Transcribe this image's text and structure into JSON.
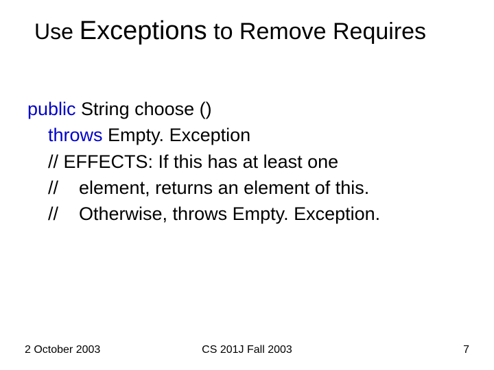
{
  "title": {
    "use": "Use ",
    "exceptions": "Exceptions",
    "rest": " to Remove Requires"
  },
  "code": {
    "l1_kw1": "public",
    "l1_rest": " String choose ()",
    "l2_indent": "    ",
    "l2_kw1": "throws",
    "l2_rest": " Empty. Exception",
    "l3": "    // EFFECTS: If this has at least one",
    "l4": "    //    element, returns an element of this.",
    "l5": "    //    Otherwise, throws Empty. Exception."
  },
  "footer": {
    "date": "2 October 2003",
    "course": "CS 201J Fall 2003",
    "page": "7"
  }
}
